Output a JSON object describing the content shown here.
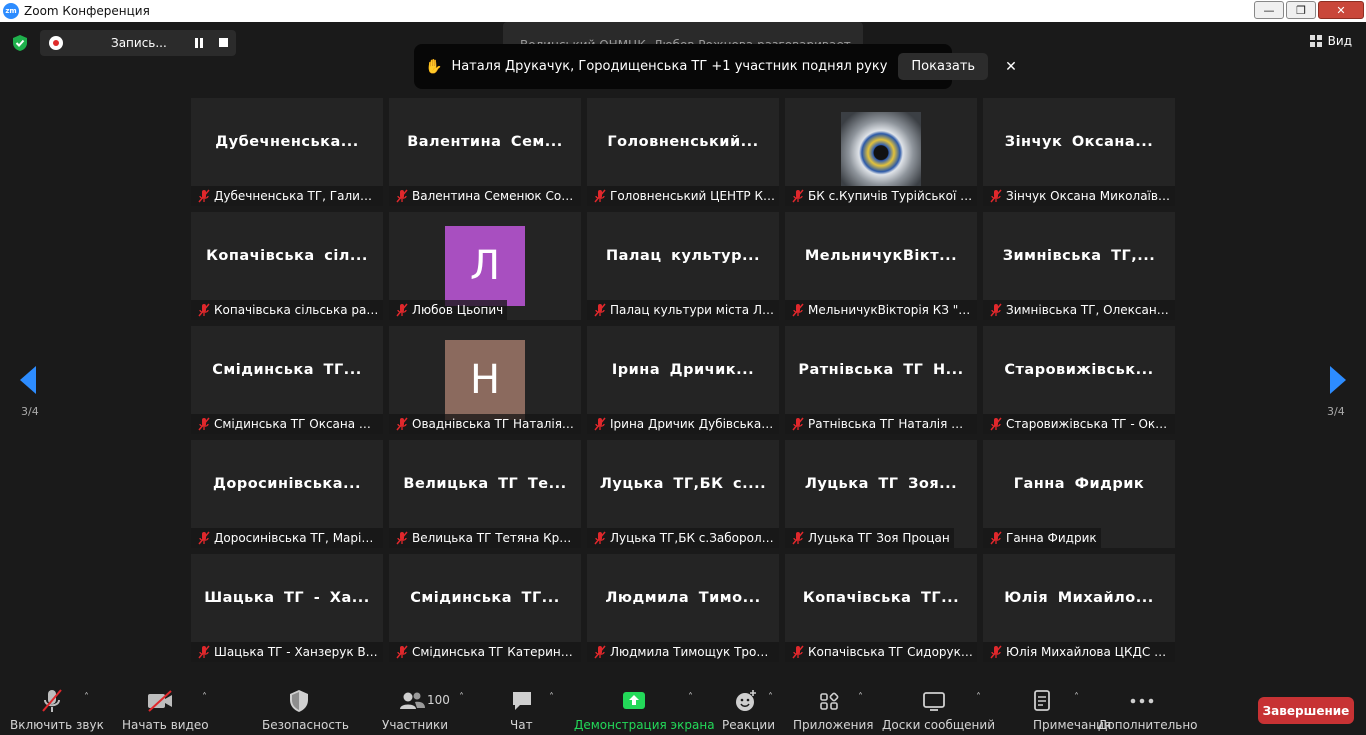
{
  "window": {
    "title": "Zoom Конференция",
    "icon_text": "zm"
  },
  "top": {
    "recording_label": "Запись...",
    "view_label": "Вид",
    "speaking_text": "Волинський ОНМЦК, Любов Рожнова разговаривает...",
    "raise_hand": {
      "text": "Наталя Друкачук, Городищенська ТГ +1 участник поднял руку",
      "show_label": "Показать",
      "close_glyph": "✕"
    }
  },
  "pagination": {
    "left": "3/4",
    "right": "3/4"
  },
  "tiles": [
    {
      "title": "Дубечненська...",
      "name": "Дубечненська ТГ, Галина ..."
    },
    {
      "title": "Валентина  Сем...",
      "name": "Валентина Семенюк Соши..."
    },
    {
      "title": "Головненський...",
      "name": "Головненський ЦЕНТР КД..."
    },
    {
      "title": "",
      "name": "БК с.Купичів Турійської ТГ",
      "image": "eye-image"
    },
    {
      "title": "Зінчук  Оксана...",
      "name": "Зінчук Оксана Миколаївна"
    },
    {
      "title": "Копачівська  сіл...",
      "name": "Копачівська сільська рада"
    },
    {
      "title": "",
      "name": "Любов Цьопич",
      "avatar": "Л",
      "avatar_color": "#a84fc0"
    },
    {
      "title": "Палац  культур...",
      "name": "Палац культури міста Луц..."
    },
    {
      "title": "МельничукВікт...",
      "name": "МельничукВікторія КЗ \"Це..."
    },
    {
      "title": "Зимнівська ТГ,...",
      "name": "Зимнівська ТГ, Олександр..."
    },
    {
      "title": "Смідинська  ТГ...",
      "name": "Смідинська ТГ Оксана Пет..."
    },
    {
      "title": "",
      "name": "Оваднівська ТГ Наталія С...",
      "avatar": "Н",
      "avatar_color": "#8b6a5e"
    },
    {
      "title": "Ірина  Дричик...",
      "name": "Ірина Дричик Дубівська Г..."
    },
    {
      "title": "Ратнівська ТГ Н...",
      "name": "Ратнівська ТГ Наталія Юхи..."
    },
    {
      "title": "Старовижівськ...",
      "name": "Старовижівська ТГ - Окса..."
    },
    {
      "title": "Доросинівська...",
      "name": "Доросинівська ТГ, Марія ..."
    },
    {
      "title": "Велицька ТГ Те...",
      "name": "Велицька ТГ Тетяна Кропи..."
    },
    {
      "title": "Луцька ТГ,БК с....",
      "name": "Луцька ТГ,БК с.Забороль ..."
    },
    {
      "title": "Луцька ТГ Зоя...",
      "name": "Луцька ТГ Зоя Процан"
    },
    {
      "title": "Ганна Фидрик",
      "name": "Ганна Фидрик"
    },
    {
      "title": "Шацька ТГ - Ха...",
      "name": "Шацька ТГ - Ханзерук Вал..."
    },
    {
      "title": "Смідинська  ТГ...",
      "name": "Смідинська ТГ Катерина Р..."
    },
    {
      "title": "Людмила  Тимо...",
      "name": "Людмила Тимощук Троя ..."
    },
    {
      "title": "Копачівська  ТГ...",
      "name": "Копачівська ТГ  Сидорук ..."
    },
    {
      "title": "Юлія  Михайло...",
      "name": "Юлія Михайлова ЦКДС К..."
    }
  ],
  "toolbar": {
    "unmute_label": "Включить звук",
    "video_label": "Начать видео",
    "security_label": "Безопасность",
    "participants_label": "Участники",
    "participants_count": "100",
    "chat_label": "Чат",
    "share_label": "Демонстрация экрана",
    "reactions_label": "Реакции",
    "apps_label": "Приложения",
    "whiteboards_label": "Доски сообщений",
    "notes_label": "Примечания",
    "more_label": "Дополнительно",
    "end_label": "Завершение"
  },
  "colors": {
    "accent_blue": "#2d8cff",
    "share_green": "#23d959",
    "end_red": "#c73234",
    "muted_red": "#e0282c"
  }
}
